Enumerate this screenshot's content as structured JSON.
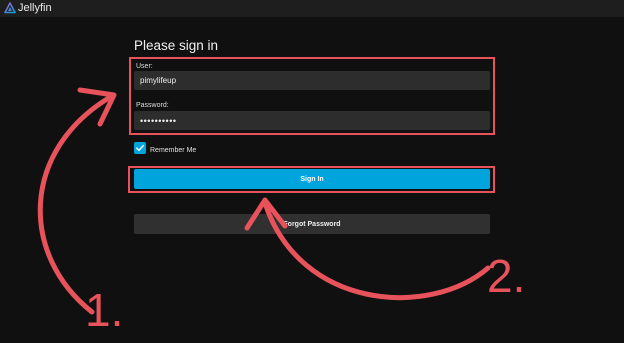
{
  "app": {
    "title": "Jellyfin"
  },
  "login": {
    "heading": "Please sign in",
    "user_label": "User:",
    "user_value": "pimylifeup",
    "password_label": "Password:",
    "password_value": "••••••••••",
    "remember_label": "Remember Me",
    "remember_checked": true,
    "signin_label": "Sign In",
    "forgot_label": "Forgot Password"
  },
  "annotations": {
    "step1": "1.",
    "step2": "2.",
    "color": "#e8535b"
  },
  "colors": {
    "accent": "#00a4dc",
    "background": "#101010",
    "input": "#2d2d2d"
  }
}
